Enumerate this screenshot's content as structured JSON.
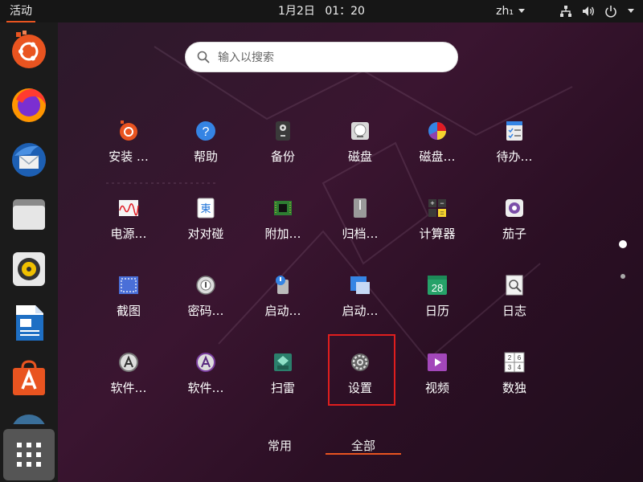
{
  "topbar": {
    "activities": "活动",
    "date": "1月2日",
    "time": "01：20",
    "input_method": "zh₁"
  },
  "search": {
    "placeholder": "输入以搜索"
  },
  "apps": [
    {
      "label": "安装 …",
      "icon": "ubuntu-install-icon"
    },
    {
      "label": "帮助",
      "icon": "help-icon"
    },
    {
      "label": "备份",
      "icon": "backup-icon"
    },
    {
      "label": "磁盘",
      "icon": "disks-icon"
    },
    {
      "label": "磁盘…",
      "icon": "disk-usage-icon"
    },
    {
      "label": "待办…",
      "icon": "todo-icon"
    },
    {
      "label": "电源…",
      "icon": "power-stats-icon"
    },
    {
      "label": "对对碰",
      "icon": "mahjongg-icon"
    },
    {
      "label": "附加…",
      "icon": "additional-drivers-icon"
    },
    {
      "label": "归档…",
      "icon": "archive-manager-icon"
    },
    {
      "label": "计算器",
      "icon": "calculator-icon"
    },
    {
      "label": "茄子",
      "icon": "cheese-icon"
    },
    {
      "label": "截图",
      "icon": "screenshot-icon"
    },
    {
      "label": "密码…",
      "icon": "passwords-icon"
    },
    {
      "label": "启动…",
      "icon": "startup-disk-icon"
    },
    {
      "label": "启动…",
      "icon": "startup-apps-icon"
    },
    {
      "label": "日历",
      "icon": "calendar-icon"
    },
    {
      "label": "日志",
      "icon": "logs-icon"
    },
    {
      "label": "软件…",
      "icon": "software-updater-icon"
    },
    {
      "label": "软件…",
      "icon": "software-properties-icon"
    },
    {
      "label": "扫雷",
      "icon": "mines-icon"
    },
    {
      "label": "设置",
      "icon": "settings-gear-icon"
    },
    {
      "label": "视频",
      "icon": "videos-icon"
    },
    {
      "label": "数独",
      "icon": "sudoku-icon"
    }
  ],
  "calendar_day": "28",
  "sudoku_digits": [
    "2",
    "6",
    "3",
    "4"
  ],
  "tabs": {
    "frequent": "常用",
    "all": "全部"
  },
  "colors": {
    "accent": "#e95420",
    "selection": "#e01e1e"
  }
}
